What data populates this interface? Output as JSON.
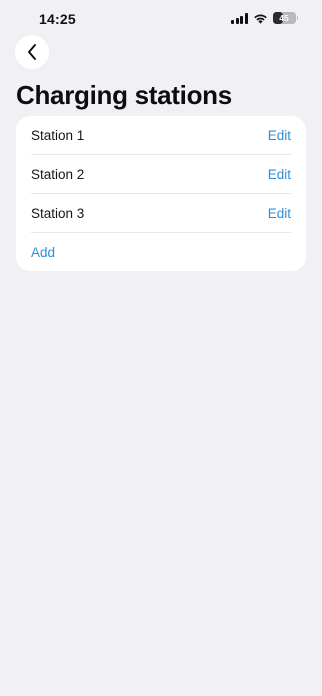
{
  "status_bar": {
    "time": "14:25",
    "battery_level": "45"
  },
  "header": {
    "back_icon": "chevron-left-icon",
    "title": "Charging stations"
  },
  "stations": [
    {
      "name": "Station 1",
      "action": "Edit"
    },
    {
      "name": "Station 2",
      "action": "Edit"
    },
    {
      "name": "Station 3",
      "action": "Edit"
    }
  ],
  "add_label": "Add",
  "colors": {
    "background": "#f1f0f5",
    "card": "#ffffff",
    "accent": "#2f8fd6"
  }
}
